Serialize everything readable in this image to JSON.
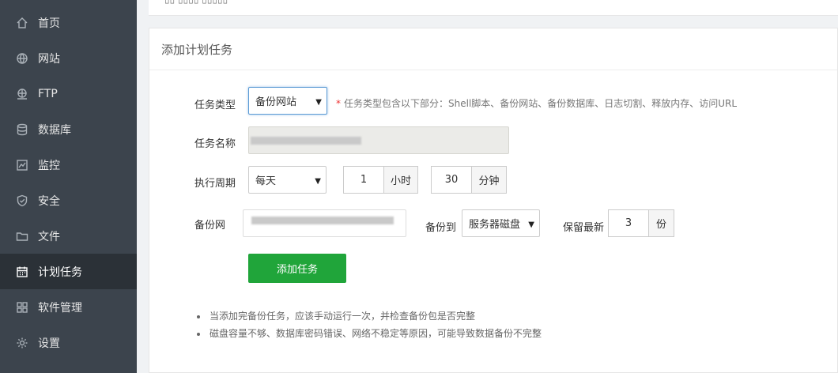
{
  "sidebar": {
    "items": [
      {
        "label": "首页",
        "icon": "home-icon"
      },
      {
        "label": "网站",
        "icon": "globe-icon"
      },
      {
        "label": "FTP",
        "icon": "ftp-icon"
      },
      {
        "label": "数据库",
        "icon": "database-icon"
      },
      {
        "label": "监控",
        "icon": "monitor-icon"
      },
      {
        "label": "安全",
        "icon": "shield-icon"
      },
      {
        "label": "文件",
        "icon": "folder-icon"
      },
      {
        "label": "计划任务",
        "icon": "calendar-icon",
        "active": true
      },
      {
        "label": "软件管理",
        "icon": "grid-icon"
      },
      {
        "label": "设置",
        "icon": "gear-icon"
      }
    ]
  },
  "top_card": {
    "remnant": "▯▯ ▯▯▯▯ ▯▯▯▯▯"
  },
  "card": {
    "title": "添加计划任务"
  },
  "form": {
    "task_type_label": "任务类型",
    "task_type_value": "备份网站",
    "task_type_hint": "任务类型包含以下部分：Shell脚本、备份网站、备份数据库、日志切割、释放内存、访问URL",
    "task_name_label": "任务名称",
    "period_label": "执行周期",
    "period_value": "每天",
    "hour_value": "1",
    "hour_unit": "小时",
    "minute_value": "30",
    "minute_unit": "分钟",
    "backup_site_label": "备份网",
    "backup_to_label": "备份到",
    "backup_to_value": "服务器磁盘",
    "keep_label": "保留最新",
    "keep_value": "3",
    "keep_unit": "份",
    "submit_label": "添加任务"
  },
  "notes": [
    "当添加完备份任务，应该手动运行一次，并检查备份包是否完整",
    "磁盘容量不够、数据库密码错误、网络不稳定等原因，可能导致数据备份不完整"
  ],
  "colors": {
    "sidebar": "#3c444d",
    "sidebar_active": "#2b3137",
    "accent": "#20a53a"
  }
}
